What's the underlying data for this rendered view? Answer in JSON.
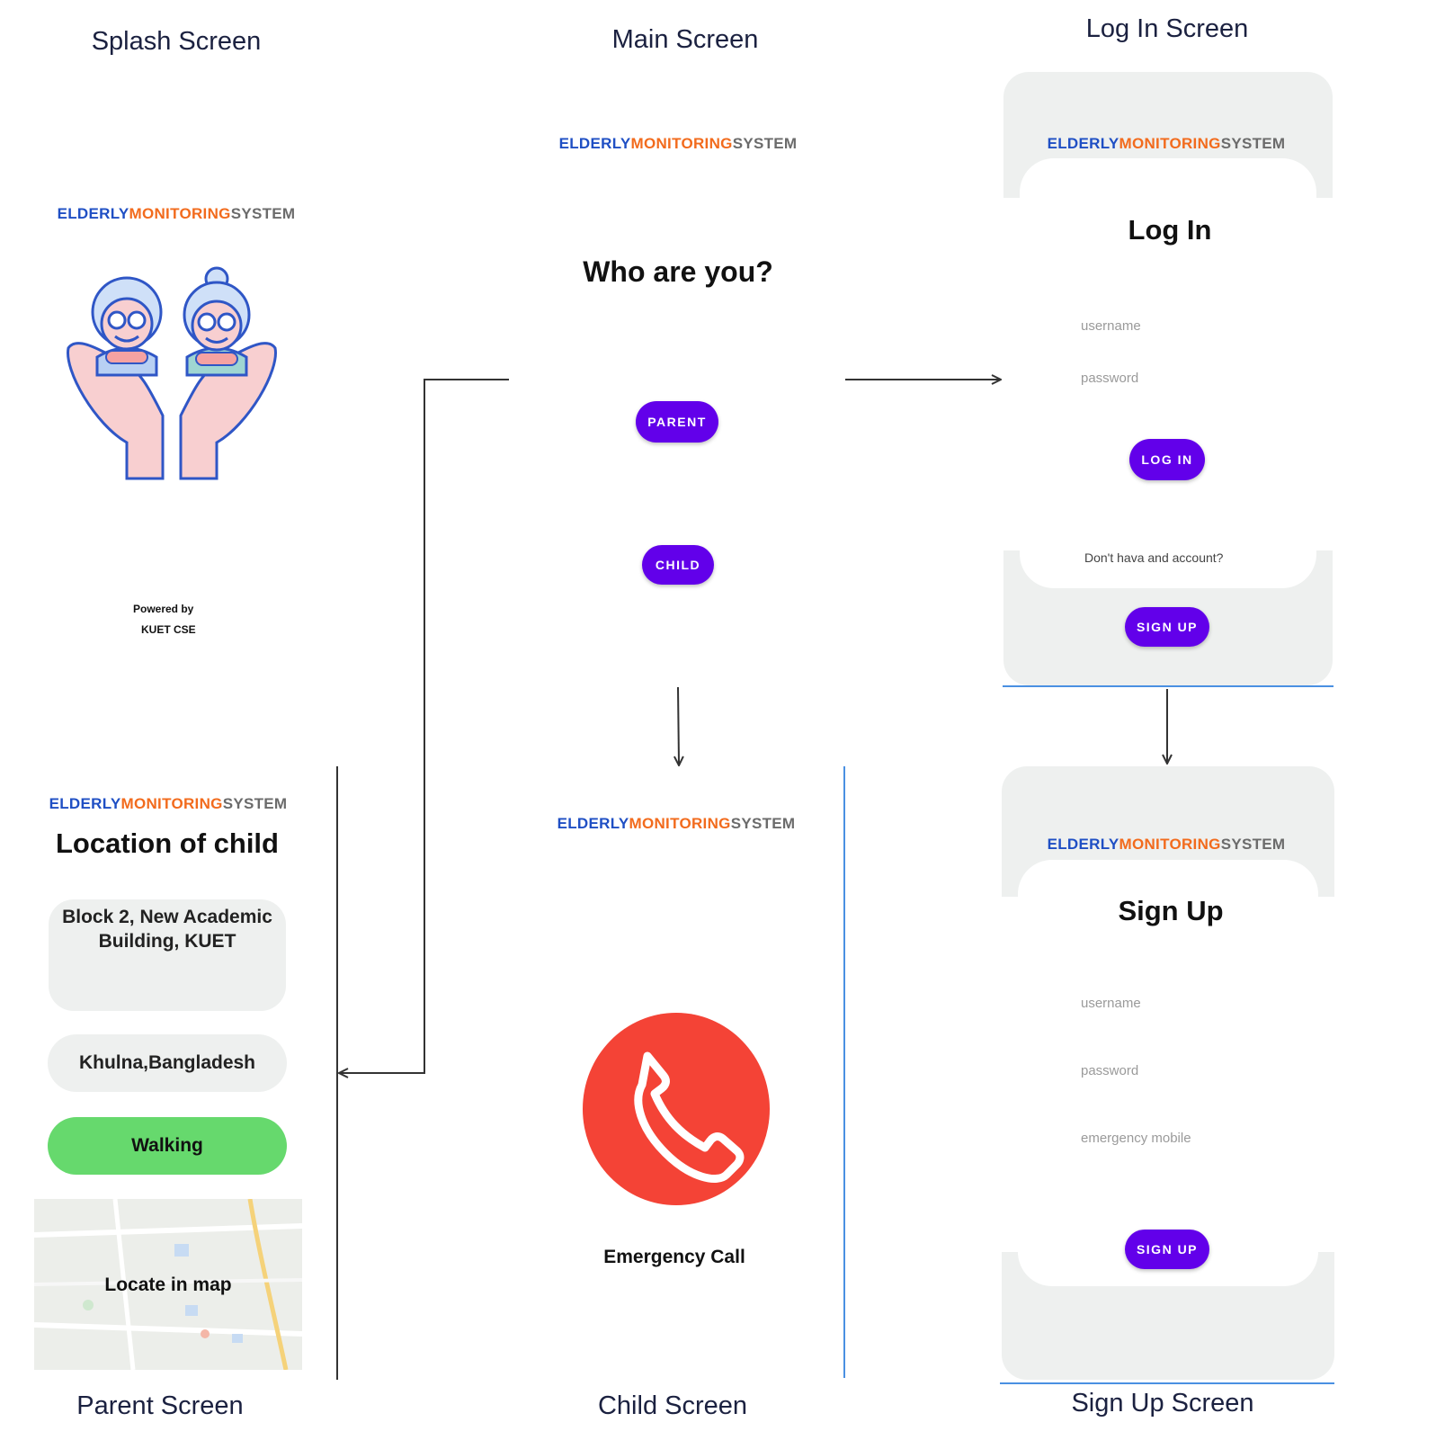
{
  "captions": {
    "splash": "Splash Screen",
    "main": "Main Screen",
    "login": "Log In Screen",
    "parent": "Parent Screen",
    "child": "Child Screen",
    "signup": "Sign Up Screen"
  },
  "brand": {
    "part1": "ELDERLY",
    "part2": "MONITORING",
    "part3": "SYSTEM"
  },
  "splash": {
    "powered_by": "Powered by",
    "org": "KUET CSE"
  },
  "main": {
    "question": "Who are you?",
    "parent_button": "PARENT",
    "child_button": "CHILD"
  },
  "login": {
    "title": "Log In",
    "username_placeholder": "username",
    "password_placeholder": "password",
    "login_button": "LOG IN",
    "no_account": "Don't hava and account?",
    "signup_button": "SIGN UP"
  },
  "signup": {
    "title": "Sign Up",
    "username_placeholder": "username",
    "password_placeholder": "password",
    "mobile_placeholder": "emergency mobile",
    "signup_button": "SIGN UP"
  },
  "parent": {
    "title": "Location of child",
    "address": "Block 2, New Academic Building, KUET",
    "city": "Khulna,Bangladesh",
    "activity": "Walking",
    "map_button": "Locate in map"
  },
  "child": {
    "emergency_label": "Emergency Call"
  },
  "colors": {
    "accent": "#6200ea",
    "brand_blue": "#1f4fc4",
    "brand_orange": "#f26b1d",
    "walking_green": "#66d96d",
    "emergency_red": "#f44336",
    "panel_grey": "#eef0ef"
  }
}
